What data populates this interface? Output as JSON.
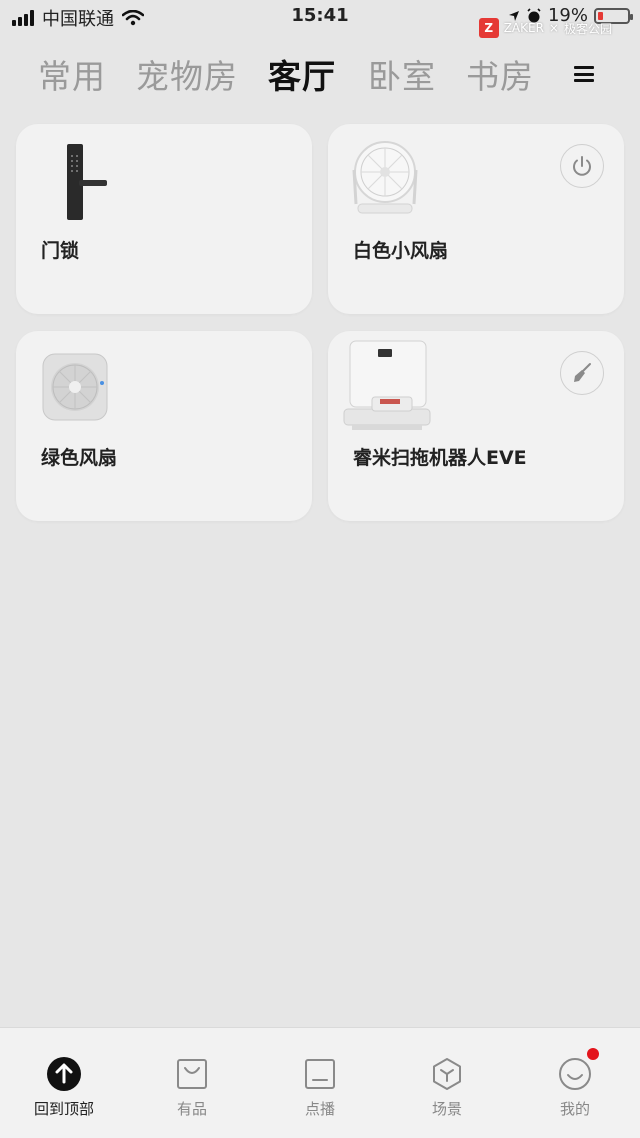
{
  "status_bar": {
    "carrier": "中国联通",
    "time": "15:41",
    "battery": "19%",
    "battery_level": 0.19,
    "watermark_brand": "ZAKER",
    "watermark_partner": "极客公园"
  },
  "tabs": [
    {
      "label": "常用",
      "active": false
    },
    {
      "label": "宠物房",
      "active": false
    },
    {
      "label": "客厅",
      "active": true
    },
    {
      "label": "卧室",
      "active": false
    },
    {
      "label": "书房",
      "active": false
    }
  ],
  "menu_icon": "hamburger-menu-icon",
  "devices": [
    {
      "name": "门锁",
      "image": "door-lock-icon",
      "action": null
    },
    {
      "name": "白色小风扇",
      "image": "white-desk-fan-icon",
      "action": "power-icon"
    },
    {
      "name": "绿色风扇",
      "image": "box-fan-icon",
      "action": null
    },
    {
      "name": "睿米扫拖机器人EVE",
      "image": "robot-vacuum-station-icon",
      "action": "broom-icon"
    }
  ],
  "bottom_nav": [
    {
      "label": "回到顶部",
      "icon": "arrow-up-circle-icon",
      "active": true
    },
    {
      "label": "有品",
      "icon": "shopping-bag-icon",
      "active": false
    },
    {
      "label": "点播",
      "icon": "tv-icon",
      "active": false
    },
    {
      "label": "场景",
      "icon": "hexagon-icon",
      "active": false
    },
    {
      "label": "我的",
      "icon": "smiley-icon",
      "active": false,
      "badge": true
    }
  ],
  "colors": {
    "background": "#e6e6e6",
    "card": "#f2f2f2",
    "active_tab": "#111111",
    "inactive_tab": "#9a9a9a",
    "badge": "#e3141b"
  }
}
